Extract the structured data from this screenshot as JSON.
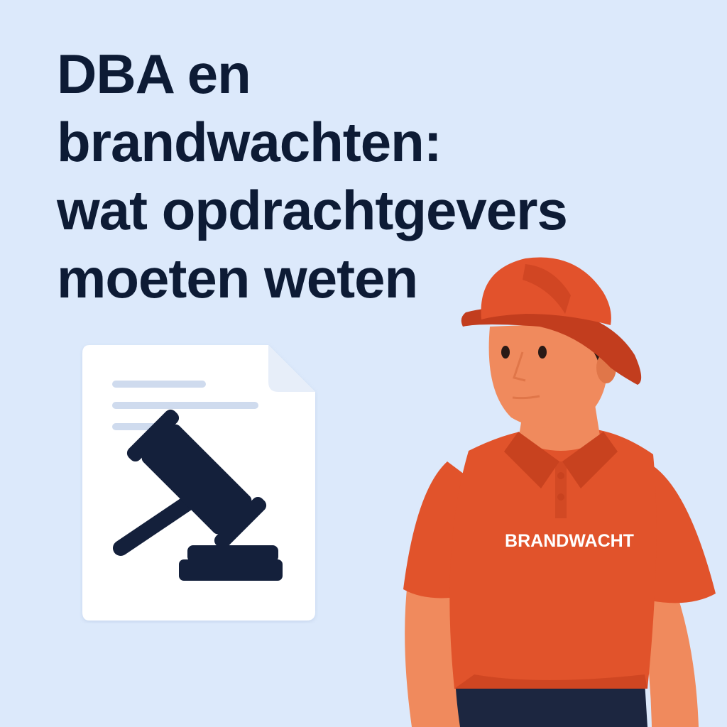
{
  "title": {
    "lines": [
      "DBA en",
      "brandwachten:",
      "wat opdrachtgevers",
      "moeten weten"
    ]
  },
  "shirt_label": "BRANDWACHT",
  "icons": {
    "document": "document-icon",
    "gavel": "gavel-icon"
  },
  "colors": {
    "background": "#dce9fb",
    "title_text": "#0d1b35",
    "document": "#ffffff",
    "document_fold": "#e7eef9",
    "document_lines": "#cfdbee",
    "gavel": "#14203b",
    "helmet": "#e2522c",
    "helmet_shadow": "#c23d1e",
    "shirt": "#e1532b",
    "shirt_shadow": "#c8421f",
    "skin": "#f08a5d",
    "skin_shadow": "#e07649",
    "hair": "#2a1a16",
    "trousers": "#1c2640",
    "shirt_label": "#ffffff"
  }
}
